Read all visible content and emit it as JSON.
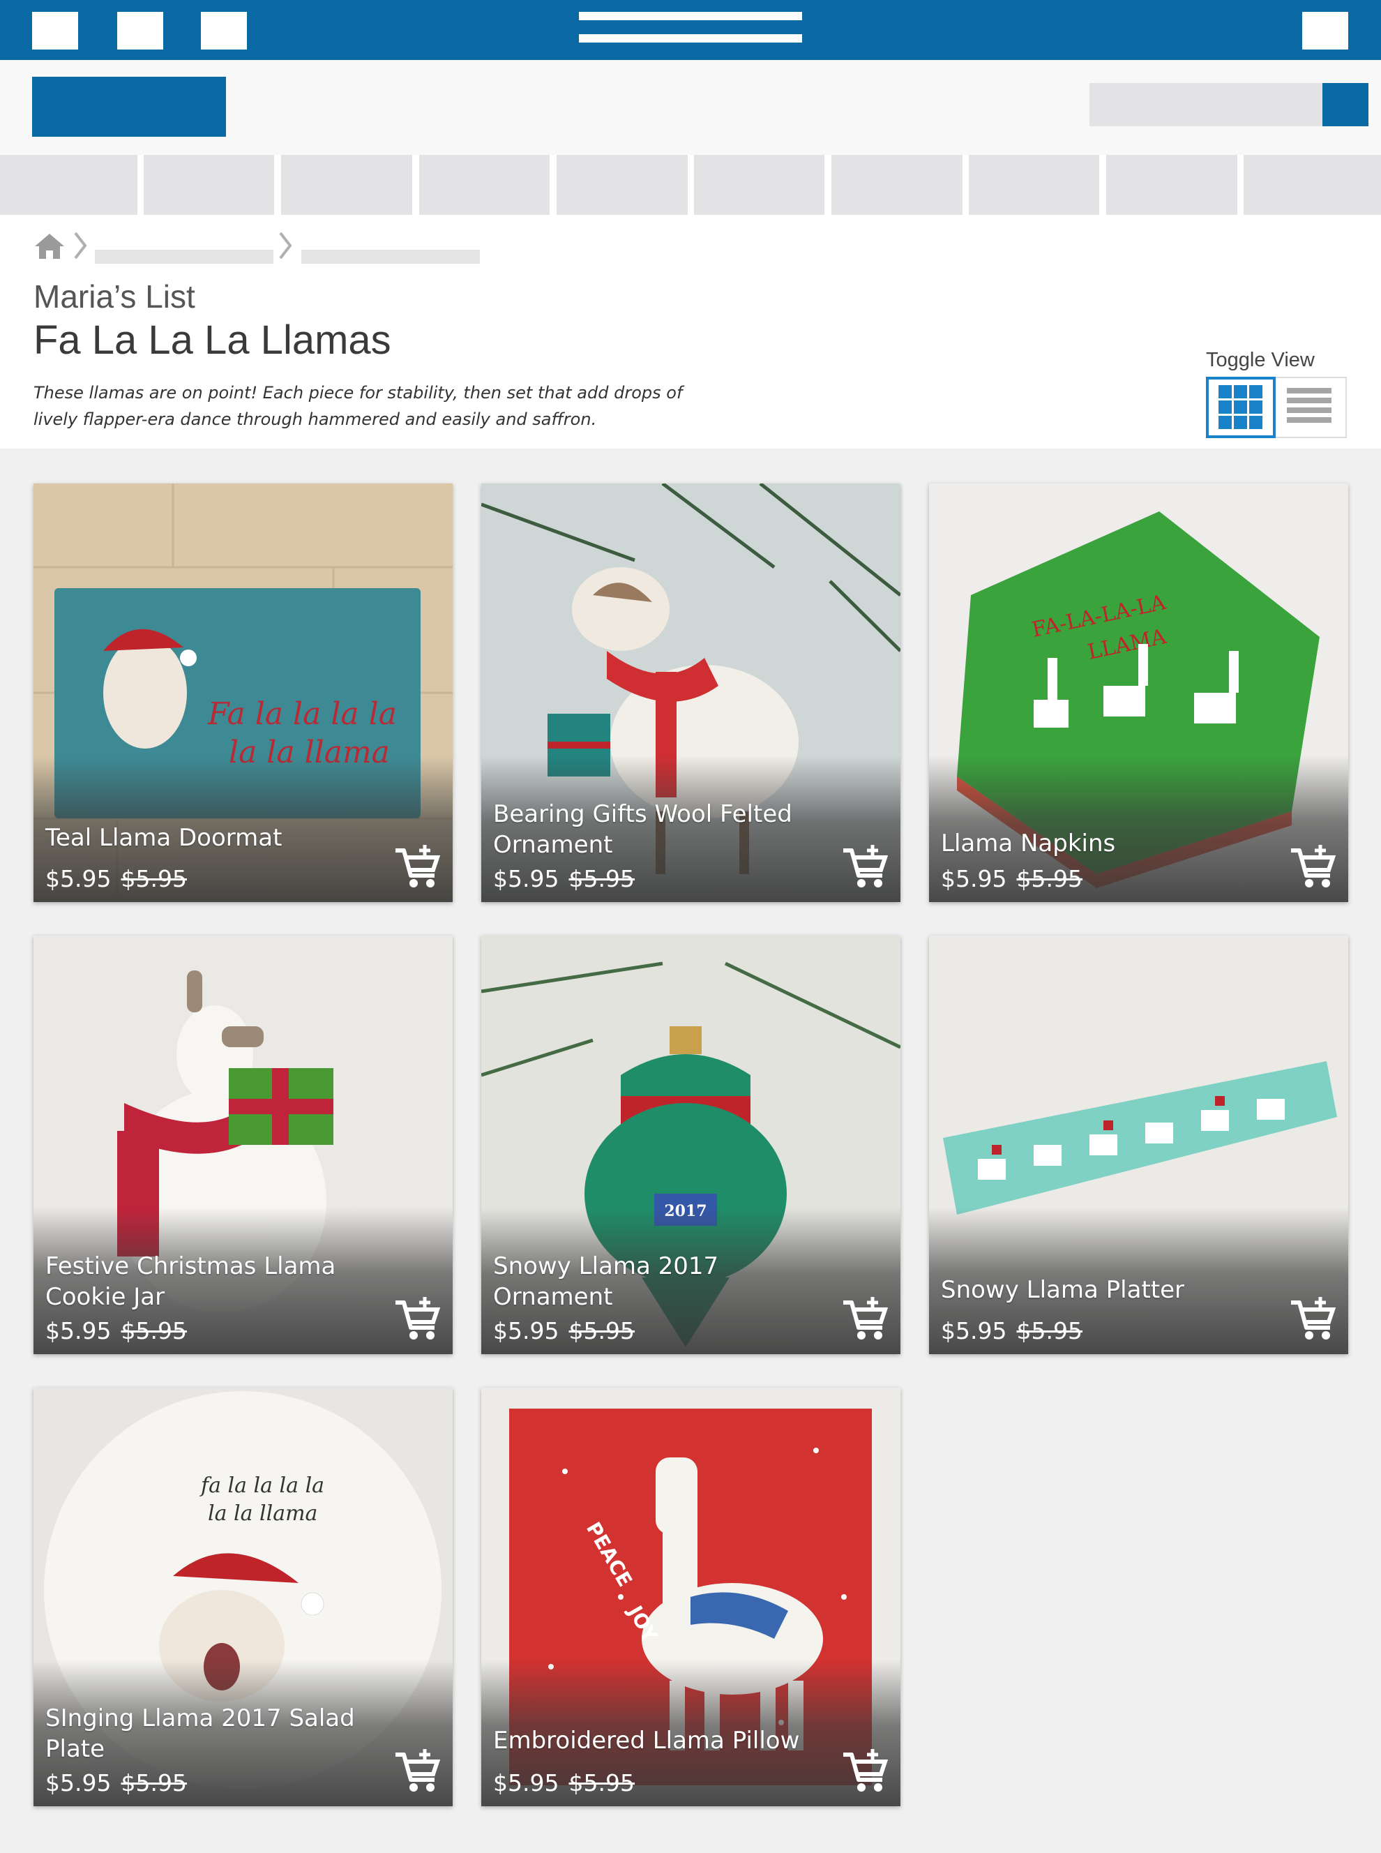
{
  "header": {
    "search_placeholder": ""
  },
  "list": {
    "owner": "Maria’s List",
    "title": "Fa La La La Llamas",
    "description": "These llamas are on point! Each piece for stability, then set that add drops of lively flapper-era dance through hammered and easily and saffron."
  },
  "toggle": {
    "label": "Toggle View",
    "active": "grid"
  },
  "products": [
    {
      "name": "Teal Llama Doormat",
      "price": "$5.95",
      "was": "$5.95",
      "image": "teal llama doormat with santa hat llama and text",
      "image_text": [
        "Fa la la la la",
        "la la llama"
      ],
      "add_icon": "add-to-cart-icon"
    },
    {
      "name": "Bearing Gifts Wool Felted Ornament",
      "price": "$5.95",
      "was": "$5.95",
      "image": "felted llama ornament with red scarf holding gift",
      "add_icon": "add-to-cart-icon"
    },
    {
      "name": "Llama Napkins",
      "price": "$5.95",
      "was": "$5.95",
      "image": "green napkins with festive llamas",
      "image_text": [
        "FA-LA-LA-LA",
        "LLAMA"
      ],
      "add_icon": "add-to-cart-icon"
    },
    {
      "name": "Festive Christmas Llama Cookie Jar",
      "price": "$5.95",
      "was": "$5.95",
      "image": "white ceramic llama cookie jar with scarf and gift",
      "add_icon": "add-to-cart-icon"
    },
    {
      "name": "Snowy Llama 2017 Ornament",
      "price": "$5.95",
      "was": "$5.95",
      "image": "green glass ornament with llama",
      "image_text": [
        "2017"
      ],
      "add_icon": "add-to-cart-icon"
    },
    {
      "name": "Snowy Llama Platter",
      "price": "$5.95",
      "was": "$5.95",
      "image": "mint platter with row of llamas",
      "add_icon": "add-to-cart-icon"
    },
    {
      "name": "SInging Llama 2017 Salad Plate",
      "price": "$5.95",
      "was": "$5.95",
      "image": "white plate with singing llama in santa hat",
      "image_text": [
        "fa la la la la",
        "la la llama"
      ],
      "add_icon": "add-to-cart-icon"
    },
    {
      "name": "Embroidered Llama Pillow",
      "price": "$5.95",
      "was": "$5.95",
      "image": "red pillow with white embroidered llama",
      "image_text": [
        "PEACE",
        "JOY"
      ],
      "add_icon": "add-to-cart-icon"
    }
  ],
  "colors": {
    "brand": "#0b69a3",
    "toggle_active": "#1a82c8",
    "background": "#f1f0f1"
  }
}
